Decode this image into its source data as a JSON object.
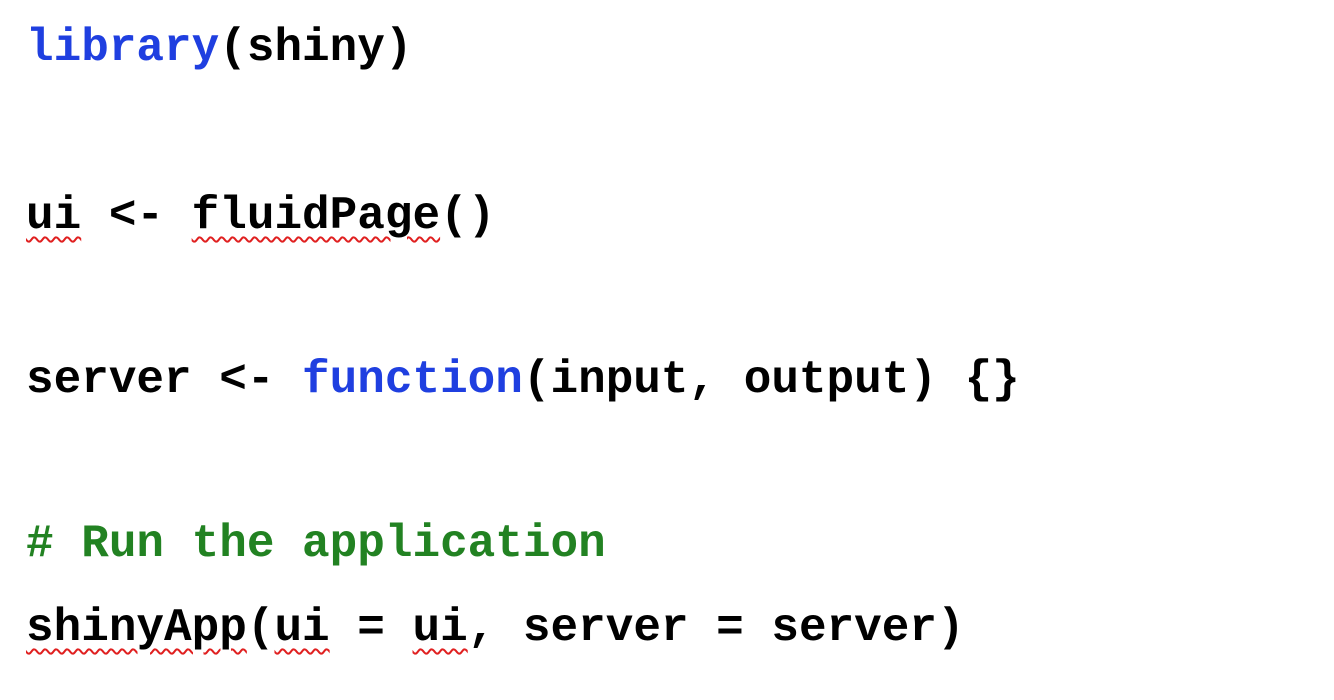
{
  "colors": {
    "keyword": "#1f3fe0",
    "comment": "#228222",
    "text": "#000000",
    "spellcheck_underline": "#e02020"
  },
  "lines": {
    "l1": {
      "fn": "library",
      "rest": "(shiny)"
    },
    "l2": {
      "var": "ui",
      "op": " <- ",
      "fn": "fluidPage",
      "rest": "()"
    },
    "l3": {
      "var": "server <- ",
      "kw": "function",
      "rest": "(input, output) {}"
    },
    "l4": {
      "comment": "# Run the application"
    },
    "l5": {
      "fn": "shinyApp",
      "paren": "(",
      "arg1": "ui",
      "eq": " = ",
      "arg1_val": "ui",
      "rest": ", server = server)"
    }
  }
}
